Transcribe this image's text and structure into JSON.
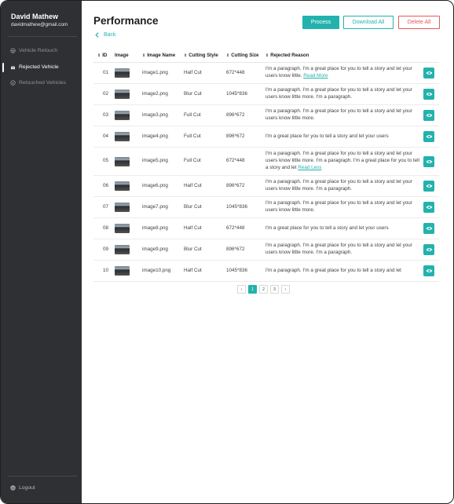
{
  "sidebar": {
    "user_name": "David Mathew",
    "user_email": "davidmathew@gmail.com",
    "items": [
      {
        "label": "Vehicle Retouch",
        "icon": "steering-wheel-icon",
        "active": false
      },
      {
        "label": "Rejected Vehicle",
        "icon": "car-icon",
        "active": true
      },
      {
        "label": "Retouched Vehicles",
        "icon": "retouch-icon",
        "active": false
      }
    ],
    "logout_label": "Logout"
  },
  "header": {
    "title": "Performance",
    "back_label": "Back",
    "process_label": "Process",
    "download_label": "Download All",
    "delete_label": "Delete All"
  },
  "table": {
    "columns": [
      "ID",
      "Image",
      "Image Name",
      "Cutting Style",
      "Cutting Size",
      "Rejected Reason"
    ],
    "rows": [
      {
        "id": "01",
        "name": "image1.png",
        "style": "Half Cut",
        "size": "672*448",
        "reason": "I'm a paragraph. I'm a great place for you to tell a story and let your users know little.",
        "link": "Read More"
      },
      {
        "id": "02",
        "name": "image2.png",
        "style": "Blur Cut",
        "size": "1045*836",
        "reason": "I'm a paragraph. I'm a great place for you to tell a story and let your users know little more. I'm a paragraph.",
        "link": ""
      },
      {
        "id": "03",
        "name": "image3.png",
        "style": "Full Cut",
        "size": "896*672",
        "reason": "I'm a paragraph. I'm a great place for you to tell a story and let your users know little more.",
        "link": ""
      },
      {
        "id": "04",
        "name": "image4.png",
        "style": "Full Cut",
        "size": "896*672",
        "reason": " I'm a great place for you to tell a story and let your users",
        "link": ""
      },
      {
        "id": "05",
        "name": "image5.png",
        "style": "Full Cut",
        "size": "672*448",
        "reason": "I'm a paragraph. I'm a great place for you to tell a story and let your users know little more. I'm a paragraph. I'm a great place for you to tell a story and let",
        "link": "Read Less"
      },
      {
        "id": "06",
        "name": "image6.png",
        "style": "Half Cut",
        "size": "896*672",
        "reason": "I'm a paragraph. I'm a great place for you to tell a story and let your users know little more. I'm a paragraph.",
        "link": ""
      },
      {
        "id": "07",
        "name": "image7.png",
        "style": "Blur Cut",
        "size": "1045*836",
        "reason": "I'm a paragraph. I'm a great place for you to tell a story and let your users know little more.",
        "link": ""
      },
      {
        "id": "08",
        "name": "image8.png",
        "style": "Half Cut",
        "size": "672*448",
        "reason": "I'm a great place for you to tell a story and let your users",
        "link": ""
      },
      {
        "id": "09",
        "name": "image9.png",
        "style": "Blur Cut",
        "size": "896*672",
        "reason": "I'm a paragraph. I'm a great place for you to tell a story and let your users know little more. I'm a paragraph.",
        "link": ""
      },
      {
        "id": "10",
        "name": "image10.png",
        "style": "Half Cut",
        "size": "1045*836",
        "reason": "I'm a paragraph. I'm a great place for you to tell a story and let",
        "link": ""
      }
    ]
  },
  "pagination": {
    "prev": "‹",
    "pages": [
      "1",
      "2",
      "3"
    ],
    "current": "1",
    "next": "›"
  },
  "colors": {
    "accent": "#23b2ad",
    "danger": "#e2585a",
    "sidebar_bg": "#2e3033"
  }
}
